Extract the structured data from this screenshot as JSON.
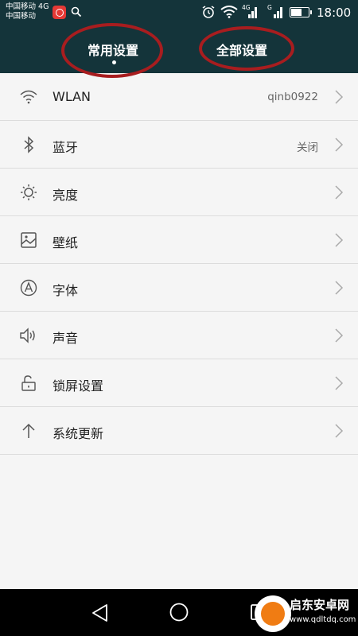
{
  "status_bar": {
    "carrier_line1": "中国移动 4G",
    "carrier_line2": "中国移动",
    "left_net": "4G",
    "sig1_net": "4G",
    "sig2_net": "G",
    "battery_level": 0.58,
    "time": "18:00"
  },
  "tabs": [
    {
      "label": "常用设置",
      "active": true
    },
    {
      "label": "全部设置",
      "active": false
    }
  ],
  "settings": [
    {
      "icon": "wifi-icon",
      "label": "WLAN",
      "value": "qinb0922"
    },
    {
      "icon": "bluetooth-icon",
      "label": "蓝牙",
      "value": "关闭"
    },
    {
      "icon": "brightness-icon",
      "label": "亮度",
      "value": ""
    },
    {
      "icon": "wallpaper-icon",
      "label": "壁纸",
      "value": ""
    },
    {
      "icon": "font-icon",
      "label": "字体",
      "value": ""
    },
    {
      "icon": "volume-icon",
      "label": "声音",
      "value": ""
    },
    {
      "icon": "unlock-icon",
      "label": "锁屏设置",
      "value": ""
    },
    {
      "icon": "arrow-up-icon",
      "label": "系统更新",
      "value": ""
    }
  ],
  "annotation_color": "#a81d1f",
  "watermark": {
    "text": "启东安卓网",
    "url": "www.qdltdq.com"
  }
}
